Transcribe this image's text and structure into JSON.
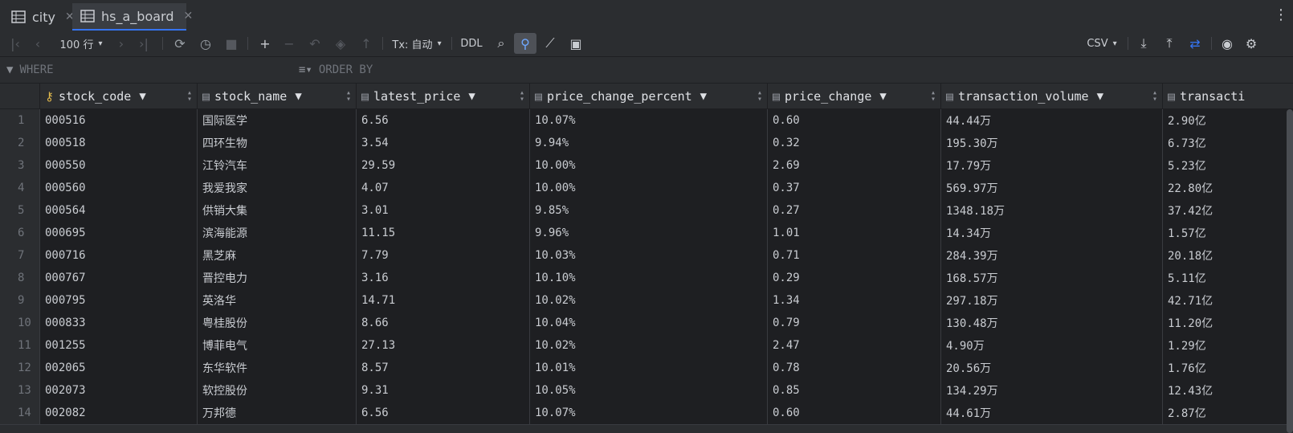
{
  "tabs": [
    {
      "label": "city",
      "active": false
    },
    {
      "label": "hs_a_board",
      "active": true
    }
  ],
  "toolbar": {
    "rows_limit": "100 行",
    "tx_mode": "Tx: 自动",
    "ddl_label": "DDL",
    "export_format": "CSV"
  },
  "filter": {
    "where_placeholder": "WHERE",
    "order_placeholder": "ORDER BY"
  },
  "columns": [
    {
      "name": "stock_code",
      "key": true
    },
    {
      "name": "stock_name"
    },
    {
      "name": "latest_price"
    },
    {
      "name": "price_change_percent"
    },
    {
      "name": "price_change"
    },
    {
      "name": "transaction_volume"
    },
    {
      "name": "transacti"
    }
  ],
  "rows": [
    {
      "n": "1",
      "cells": [
        "000516",
        "国际医学",
        "6.56",
        "10.07%",
        "0.60",
        "44.44万",
        "2.90亿"
      ]
    },
    {
      "n": "2",
      "cells": [
        "000518",
        "四环生物",
        "3.54",
        "9.94%",
        "0.32",
        "195.30万",
        "6.73亿"
      ]
    },
    {
      "n": "3",
      "cells": [
        "000550",
        "江铃汽车",
        "29.59",
        "10.00%",
        "2.69",
        "17.79万",
        "5.23亿"
      ]
    },
    {
      "n": "4",
      "cells": [
        "000560",
        "我爱我家",
        "4.07",
        "10.00%",
        "0.37",
        "569.97万",
        "22.80亿"
      ]
    },
    {
      "n": "5",
      "cells": [
        "000564",
        "供销大集",
        "3.01",
        "9.85%",
        "0.27",
        "1348.18万",
        "37.42亿"
      ]
    },
    {
      "n": "6",
      "cells": [
        "000695",
        "滨海能源",
        "11.15",
        "9.96%",
        "1.01",
        "14.34万",
        "1.57亿"
      ]
    },
    {
      "n": "7",
      "cells": [
        "000716",
        "黑芝麻",
        "7.79",
        "10.03%",
        "0.71",
        "284.39万",
        "20.18亿"
      ]
    },
    {
      "n": "8",
      "cells": [
        "000767",
        "晋控电力",
        "3.16",
        "10.10%",
        "0.29",
        "168.57万",
        "5.11亿"
      ]
    },
    {
      "n": "9",
      "cells": [
        "000795",
        "英洛华",
        "14.71",
        "10.02%",
        "1.34",
        "297.18万",
        "42.71亿"
      ]
    },
    {
      "n": "10",
      "cells": [
        "000833",
        "粤桂股份",
        "8.66",
        "10.04%",
        "0.79",
        "130.48万",
        "11.20亿"
      ]
    },
    {
      "n": "11",
      "cells": [
        "001255",
        "博菲电气",
        "27.13",
        "10.02%",
        "2.47",
        "4.90万",
        "1.29亿"
      ]
    },
    {
      "n": "12",
      "cells": [
        "002065",
        "东华软件",
        "8.57",
        "10.01%",
        "0.78",
        "20.56万",
        "1.76亿"
      ]
    },
    {
      "n": "13",
      "cells": [
        "002073",
        "软控股份",
        "9.31",
        "10.05%",
        "0.85",
        "134.29万",
        "12.43亿"
      ]
    },
    {
      "n": "14",
      "cells": [
        "002082",
        "万邦德",
        "6.56",
        "10.07%",
        "0.60",
        "44.61万",
        "2.87亿"
      ]
    }
  ],
  "icons": {
    "first": "first-page-icon",
    "prev": "prev-page-icon",
    "next": "next-page-icon",
    "last": "last-page-icon",
    "reload": "reload-icon",
    "history": "history-icon",
    "stop": "stop-icon",
    "add": "add-row-icon",
    "remove": "remove-row-icon",
    "revert": "revert-icon",
    "submit": "submit-icon",
    "push": "push-icon",
    "search": "search-icon",
    "filter": "filter-icon",
    "chart": "chart-icon",
    "view": "view-icon"
  },
  "colors": {
    "accent": "#3574f0",
    "key": "#e0b84c"
  }
}
